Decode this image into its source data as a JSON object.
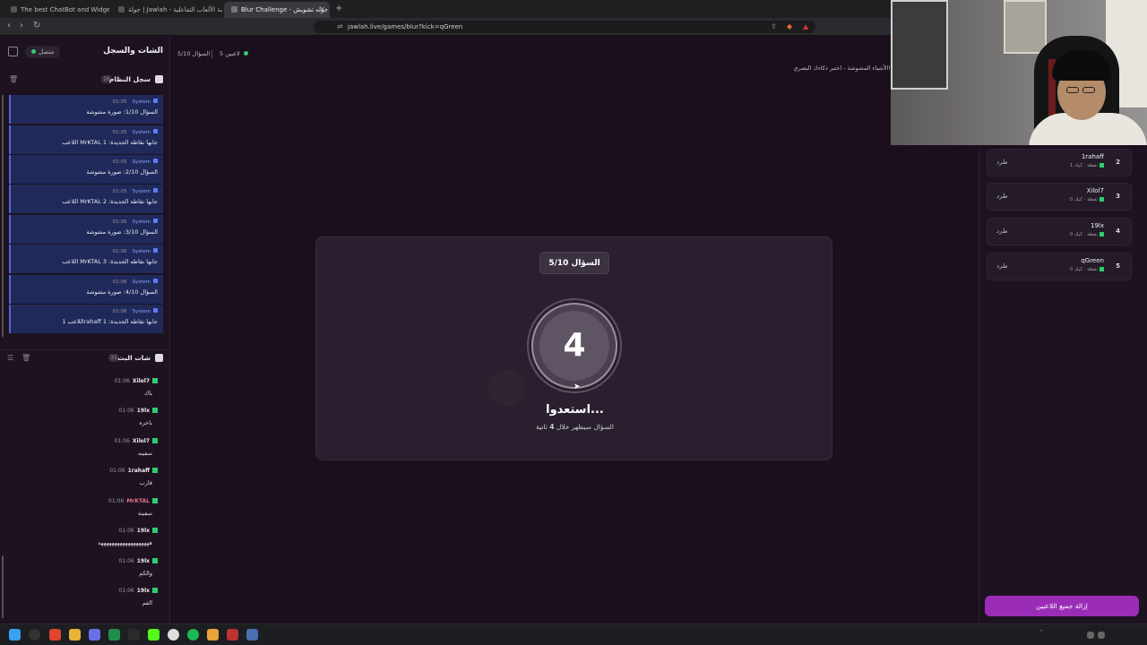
{
  "browser": {
    "tabs": [
      {
        "title": "The best ChatBot and Widgets for K"
      },
      {
        "title": "جولة | Jawlah - منصة الألعاب التفاعلية"
      },
      {
        "title": "Blur Challenge - جوله تشويش"
      }
    ],
    "url": "jawlah.live/games/blur?kick=qGreen"
  },
  "sidebar": {
    "title": "الشات والسجل",
    "status_label": "متصل",
    "system_log": {
      "title": "سجل النظام",
      "count": "16",
      "items": [
        {
          "source": "System",
          "time": "01:05",
          "text": "السؤال 1/10: صورة مشوشة"
        },
        {
          "source": "System",
          "time": "01:05",
          "text": "اللاعب MrKTAL جابها نقاطه الجديدة: 1"
        },
        {
          "source": "System",
          "time": "01:05",
          "text": "السؤال 2/10: صورة مشوشة"
        },
        {
          "source": "System",
          "time": "01:05",
          "text": "اللاعب MrKTAL جابها نقاطه الجديدة: 2"
        },
        {
          "source": "System",
          "time": "01:06",
          "text": "السؤال 3/10: صورة مشوشة"
        },
        {
          "source": "System",
          "time": "01:06",
          "text": "اللاعب MrKTAL جابها نقاطه الجديدة: 3"
        },
        {
          "source": "System",
          "time": "01:06",
          "text": "السؤال 4/10: صورة مشوشة"
        },
        {
          "source": "System",
          "time": "01:06",
          "text": "اللاعب 1rahaff جابها نقاطه الجديدة: 1"
        }
      ]
    },
    "live_chat": {
      "title": "شات البث",
      "count": "31",
      "messages": [
        {
          "user": "Xilol7",
          "time": "01:06",
          "text": "باك"
        },
        {
          "user": "19lx",
          "time": "01:06",
          "text": "باخره"
        },
        {
          "user": "Xilol7",
          "time": "01:06",
          "text": "سفينه"
        },
        {
          "user": "1rahaff",
          "time": "01:06",
          "text": "قارب"
        },
        {
          "user": "MrKTAL",
          "time": "01:06",
          "text": "سفينة"
        },
        {
          "user": "19lx",
          "time": "01:06",
          "text": "هههههههههههههههههههه"
        },
        {
          "user": "19lx",
          "time": "01:06",
          "text": "والكم"
        },
        {
          "user": "19lx",
          "time": "01:06",
          "text": "الفم"
        }
      ]
    }
  },
  "game": {
    "question_counter": "السؤال 5/10",
    "players_count": "5 لاعبين",
    "breadcrumb": "الأشياء المشوشة - اختبر ذكاءك البصري!",
    "question_badge": "السؤال 5/10",
    "countdown": "4",
    "ready_title": "استعدوا...",
    "subtitle_prefix": "السؤال سيظهر خلال",
    "subtitle_num": "4",
    "subtitle_suffix": "ثانية"
  },
  "players": {
    "kick_label": "طرد",
    "points_prefix": "كيك",
    "list": [
      {
        "rank": "2",
        "name": "1rahaff",
        "points": "1 نقطة"
      },
      {
        "rank": "3",
        "name": "Xilol7",
        "points": "0 نقطة"
      },
      {
        "rank": "4",
        "name": "19lx",
        "points": "0 نقطة"
      },
      {
        "rank": "5",
        "name": "qGreen",
        "points": "0 نقطة"
      }
    ],
    "clear_button": "إزالة جميع اللاعبين"
  },
  "colors": {
    "accent": "#9b2cb6",
    "log_bg": "#1f2a5a",
    "online": "#2ecc71"
  }
}
